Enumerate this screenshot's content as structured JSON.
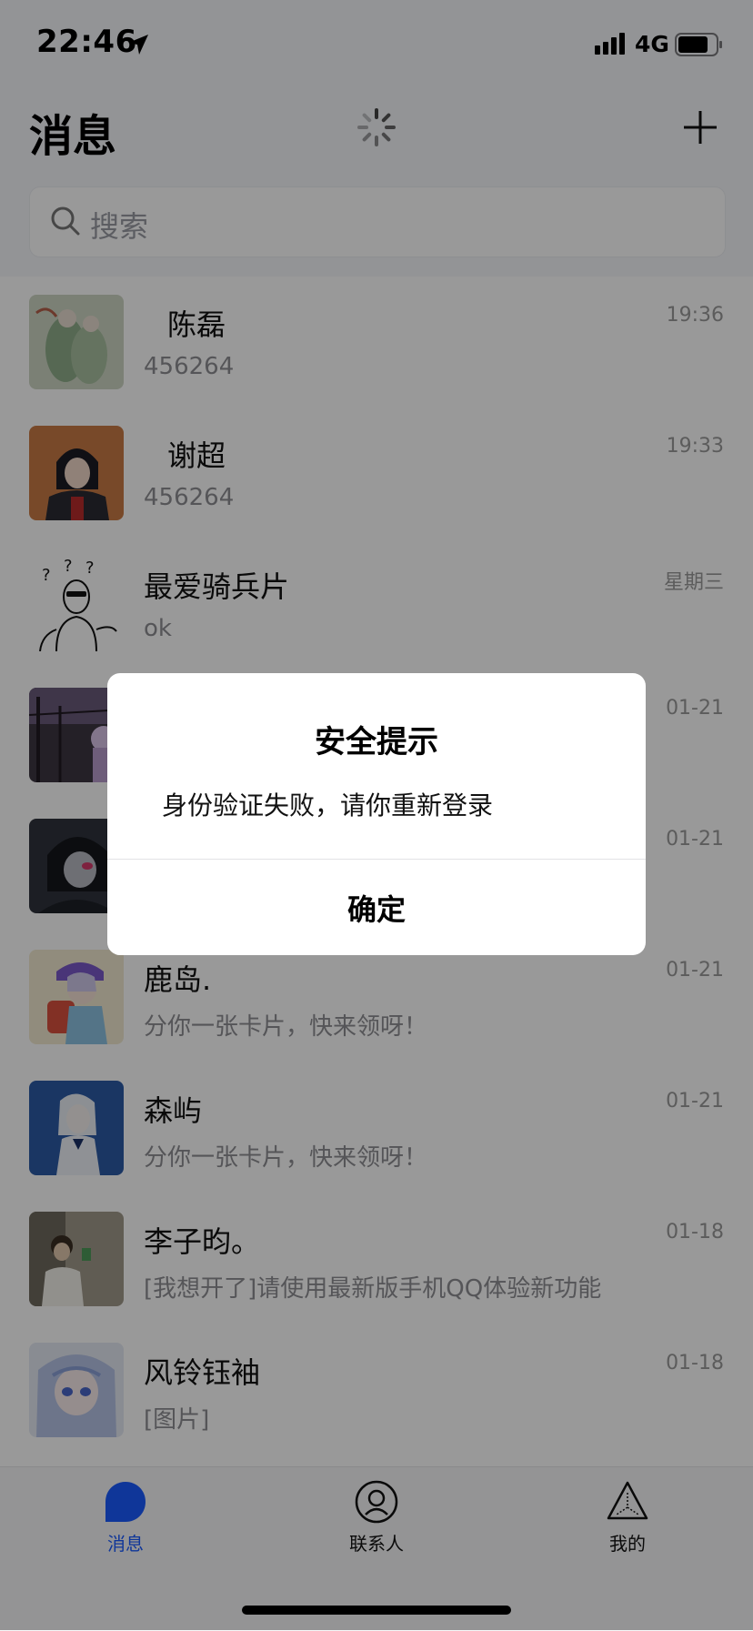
{
  "status_bar": {
    "time": "22:46",
    "network": "4G"
  },
  "header": {
    "title": "消息"
  },
  "search": {
    "placeholder": "搜索"
  },
  "chats": [
    {
      "name": "陈磊",
      "preview": "456264",
      "time": "19:36"
    },
    {
      "name": "谢超",
      "preview": "456264",
      "time": "19:33"
    },
    {
      "name": "最爱骑兵片",
      "preview": "ok",
      "time": "星期三"
    },
    {
      "name": "",
      "preview": "",
      "time": "01-21"
    },
    {
      "name": "",
      "preview": "",
      "time": "01-21"
    },
    {
      "name": "鹿岛.",
      "preview": "分你一张卡片，快来领呀！",
      "time": "01-21"
    },
    {
      "name": "森屿",
      "preview": "分你一张卡片，快来领呀！",
      "time": "01-21"
    },
    {
      "name": "李子昀。",
      "preview": "[我想开了]请使用最新版手机QQ体验新功能",
      "time": "01-18"
    },
    {
      "name": "风铃钰袖",
      "preview": "[图片]",
      "time": "01-18"
    }
  ],
  "tabs": [
    {
      "label": "消息",
      "icon": "message-bubble-icon",
      "active": true
    },
    {
      "label": "联系人",
      "icon": "contacts-icon",
      "active": false
    },
    {
      "label": "我的",
      "icon": "profile-triangle-icon",
      "active": false
    }
  ],
  "dialog": {
    "title": "安全提示",
    "message": "身份验证失败，请你重新登录",
    "confirm_label": "确定"
  },
  "colors": {
    "accent": "#1a5bff",
    "overlay": "rgba(0,0,0,0.4)"
  }
}
